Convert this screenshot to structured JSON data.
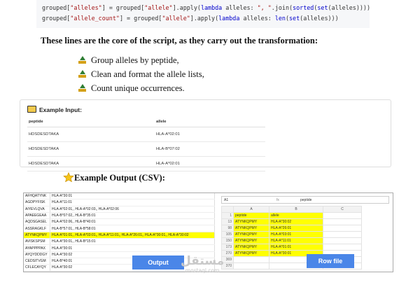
{
  "code": {
    "line1": {
      "a": "grouped[",
      "b": "\"alleles\"",
      "c": "] = grouped[",
      "d": "\"allele\"",
      "e": "].apply(",
      "f": "lambda",
      "g": " alleles: ",
      "h": "\", \"",
      "i": ".join(",
      "j": "sorted",
      "k": "(",
      "l": "set",
      "m": "(alleles))))"
    },
    "line2": {
      "a": "grouped[",
      "b": "\"allele_count\"",
      "c": "] = grouped[",
      "d": "\"allele\"",
      "e": "].apply(",
      "f": "lambda",
      "g": " alleles: ",
      "h": "len",
      "i": "(",
      "j": "set",
      "k": "(alleles)))"
    }
  },
  "heading": "These lines are the core of the script, as they carry out the transformation:",
  "bullets": [
    "Group alleles by peptide,",
    "Clean and format the allele lists,",
    "Count unique occurrences."
  ],
  "example_input": {
    "title": "Example Input:",
    "columns": [
      "peptide",
      "allele"
    ],
    "rows": [
      [
        "HDSDESDTAKA",
        "HLA-A*02:01"
      ],
      [
        "HDSDESDTAKA",
        "HLA-B*07:02"
      ],
      [
        "HDSDESDTAKA",
        "HLA-A*02:01"
      ]
    ]
  },
  "example_output_heading": "Example Output (CSV):",
  "output_table": {
    "rows": [
      [
        "AFHQATYNK",
        "HLA-A*30:01"
      ],
      [
        "AGDPYFISK",
        "HLA-A*11:01"
      ],
      [
        "AIYEVLQVA",
        "HLA-A*02:01,, HLA-A*02:03,, HLA-A*02:06"
      ],
      [
        "APAEEGEAA",
        "HLA-B*07:02,, HLA-B*35:01"
      ],
      [
        "AQDSGASEL",
        "HLA-A*02:06,, HLA-B*40:01"
      ],
      [
        "ASSRAGKLF",
        "HLA-B*57:01,, HLA-B*58:01"
      ],
      [
        "ATYNKQPMY",
        "HLA-A*01:01,, HLA-A*03:01,, HLA-A*11:01,, HLA-A*26:01,, HLA-A*30:01,, HLA-A*30:02"
      ],
      [
        "AVISKSPSM",
        "HLA-A*30:01,, HLA-B*15:01"
      ],
      [
        "AYAPPPPAX",
        "HLA-A*30:01"
      ],
      [
        "AYQYDDDGY",
        "HLA-A*30:02"
      ],
      [
        "CEDSITVGM",
        "HLA-B*40:01"
      ],
      [
        "CFLECAYQY",
        "HLA-A*30:02"
      ]
    ],
    "highlight_index": 6,
    "badge": "Output"
  },
  "excel": {
    "cell_ref": "A1",
    "fx": "fx",
    "formula_value": "peptide",
    "col_headers": [
      "",
      "A",
      "B",
      "C"
    ],
    "rows": [
      [
        "1",
        "peptide",
        "allele",
        ""
      ],
      [
        "13",
        "ATYNKQPMY",
        "HLA-A*30:02",
        ""
      ],
      [
        "98",
        "ATYNKQPMY",
        "HLA-A*26:01",
        ""
      ],
      [
        "105",
        "ATYNKQPMY",
        "HLA-A*03:01",
        ""
      ],
      [
        "150",
        "ATYNKQPMY",
        "HLA-A*11:01",
        ""
      ],
      [
        "173",
        "ATYNKQPMY",
        "HLA-A*01:01",
        ""
      ],
      [
        "270",
        "ATYNKQPMY",
        "HLA-A*30:01",
        ""
      ],
      [
        "369",
        "",
        "",
        ""
      ],
      [
        "370",
        "",
        "",
        ""
      ]
    ],
    "badge": "Row file"
  },
  "watermark": {
    "arabic": "مستقل",
    "latin": "mostaql.com"
  },
  "colors": {
    "highlight": "#ffff00",
    "badge": "#4a86e8",
    "code_bg": "#f6f7f9"
  }
}
